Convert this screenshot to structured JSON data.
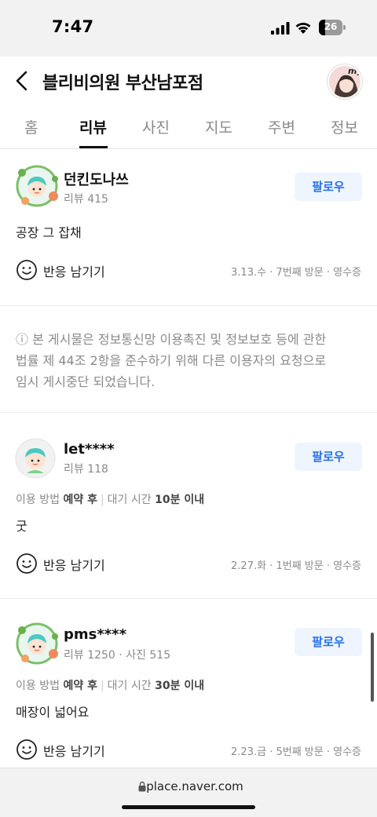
{
  "status_bar": {
    "time": "7:47",
    "battery": "26"
  },
  "header": {
    "title": "블리비의원 부산남포점",
    "avatar_label": "my"
  },
  "tabs": [
    {
      "label": "홈",
      "active": false
    },
    {
      "label": "리뷰",
      "active": true
    },
    {
      "label": "사진",
      "active": false
    },
    {
      "label": "지도",
      "active": false
    },
    {
      "label": "주변",
      "active": false
    },
    {
      "label": "정보",
      "active": false
    }
  ],
  "reviews": [
    {
      "nickname": "던킨도나쓰",
      "meta": "리뷰 415",
      "follow_label": "팔로우",
      "text": "공장 그 잡채",
      "reaction_label": "반응 남기기",
      "visit_meta": "3.13.수 · 7번째 방문 · 영수증"
    },
    {
      "nickname": "let****",
      "meta": "리뷰 118",
      "follow_label": "팔로우",
      "usage_label": "이용 방법",
      "usage_value": "예약 후",
      "wait_label": "대기 시간",
      "wait_value": "10분 이내",
      "text": "굿",
      "reaction_label": "반응 남기기",
      "visit_meta": "2.27.화 · 1번째 방문 · 영수증"
    },
    {
      "nickname": "pms****",
      "meta": "리뷰 1250 · 사진 515",
      "follow_label": "팔로우",
      "usage_label": "이용 방법",
      "usage_value": "예약 후",
      "wait_label": "대기 시간",
      "wait_value": "30분 이내",
      "text": "매장이 넓어요",
      "reaction_label": "반응 남기기",
      "visit_meta": "2.23.금 · 5번째 방문 · 영수증"
    }
  ],
  "notice": {
    "line1": "ⓘ 본 게시물은 정보통신망 이용촉진 및 정보보호 등에 관한",
    "line2": "법률 제 44조 2항을 준수하기 위해 다른 이용자의 요청으로",
    "line3": "임시 게시중단 되었습니다."
  },
  "url_bar": {
    "url": "place.naver.com"
  },
  "colors": {
    "follow_bg": "#eef5ff",
    "follow_text": "#2a73e8",
    "muted_text": "#8a8a8a"
  }
}
